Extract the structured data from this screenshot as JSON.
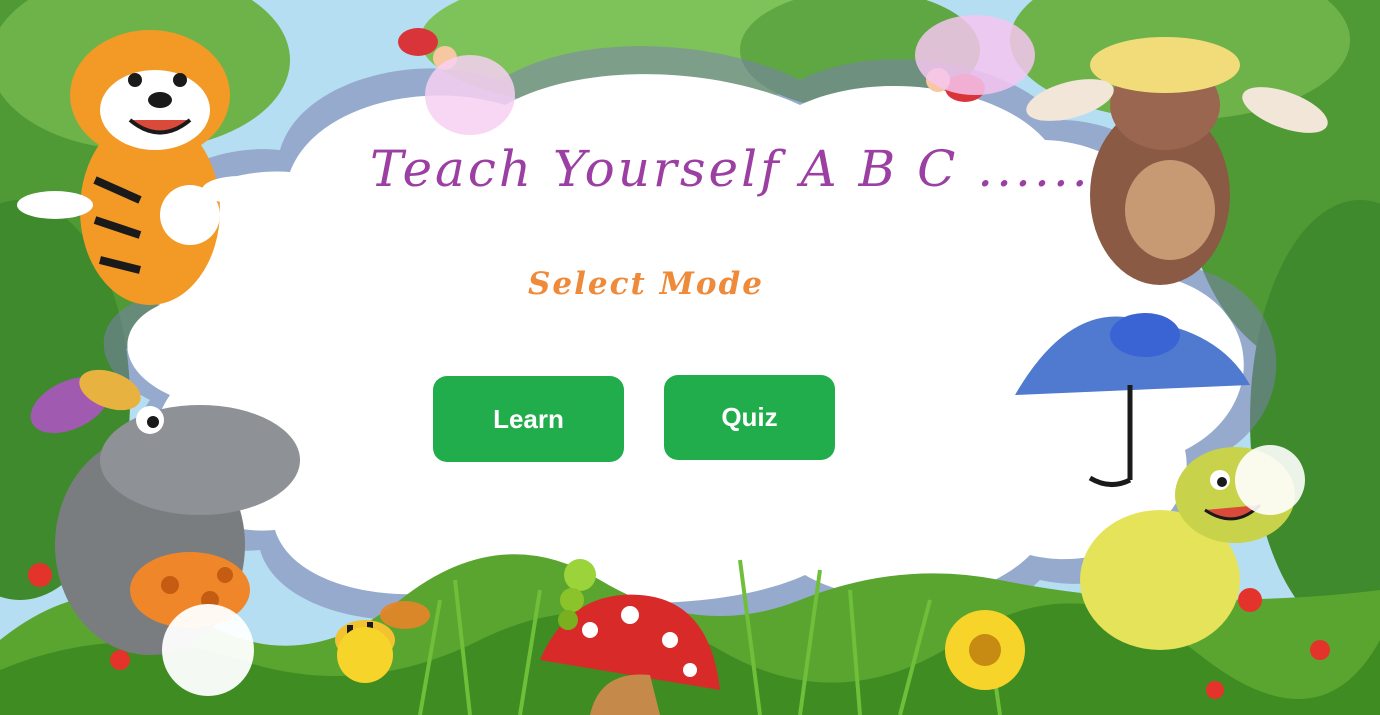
{
  "app": {
    "title": "Teach Yourself A B C ......",
    "subtitle": "Select Mode"
  },
  "buttons": {
    "learn_label": "Learn",
    "quiz_label": "Quiz"
  },
  "colors": {
    "title": "#9b3fa3",
    "subtitle": "#ee8a3a",
    "button": "#22ad4d",
    "button_text": "#ffffff"
  },
  "decorations": [
    "tiger-icon",
    "mole-icon",
    "hippo-icon",
    "turtle-icon",
    "ladybug-icon",
    "butterfly-icon",
    "umbrella-icon",
    "mushroom-icon",
    "caterpillar-icon",
    "bee-icon",
    "dandelion-icon",
    "sunflower-icon",
    "flower-icon",
    "leaves-icon",
    "grass-icon"
  ]
}
